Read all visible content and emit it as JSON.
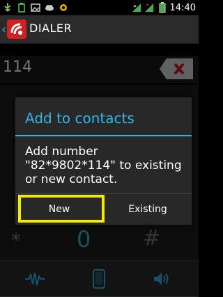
{
  "status_bar": {
    "time": "14:40",
    "icons_left": [
      "usb-icon",
      "battery-charging-icon",
      "image-icon",
      "cloud-icon",
      "notification-icon"
    ],
    "icons_right": [
      "data-signal-icon",
      "signal-icon",
      "battery-icon"
    ]
  },
  "action_bar": {
    "title": "DIALER"
  },
  "dialer": {
    "digits": "114"
  },
  "keypad": {
    "star": "*",
    "zero": "0",
    "hash": "#"
  },
  "dialog": {
    "title": "Add to contacts",
    "message": "Add number \"82*9802*114\" to existing or new contact.",
    "buttons": {
      "new": "New",
      "existing": "Existing"
    }
  },
  "colors": {
    "accent": "#33b5e5",
    "highlight": "#f2ea0b",
    "delete_red": "#c21c1c"
  }
}
